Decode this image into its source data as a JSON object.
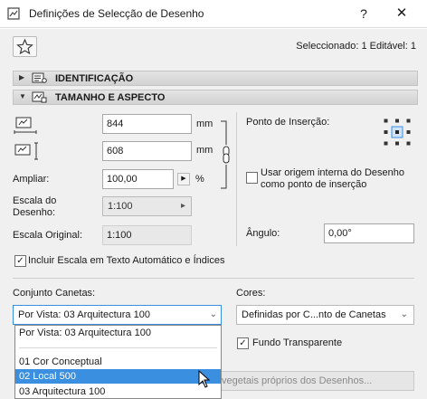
{
  "window": {
    "title": "Definições de Selecção de Desenho",
    "help": "?",
    "close": "✕"
  },
  "header": {
    "selected_info": "Seleccionado: 1 Editável: 1"
  },
  "panels": {
    "identification": "IDENTIFICAÇÃO",
    "size": "TAMANHO E ASPECTO"
  },
  "size": {
    "width_value": "844",
    "width_unit": "mm",
    "height_value": "608",
    "height_unit": "mm",
    "magnify_label": "Ampliar:",
    "magnify_value": "100,00",
    "magnify_unit": "%",
    "scale_label_line1": "Escala do",
    "scale_label_line2": "Desenho:",
    "scale_value": "1:100",
    "orig_scale_label": "Escala Original:",
    "orig_scale_value": "1:100",
    "insertion_label": "Ponto de Inserção:",
    "use_origin_line1": "Usar origem interna do Desenho",
    "use_origin_line2": "como ponto de inserção",
    "angle_label": "Ângulo:",
    "angle_value": "0,00°",
    "include_scale": "Incluir Escala em Texto Automático e Índices"
  },
  "pens": {
    "label": "Conjunto Canetas:",
    "selected": "Por Vista: 03 Arquitectura 100",
    "options": [
      "Por Vista: 03 Arquitectura 100",
      "01 Cor Conceptual",
      "02 Local 500",
      "03 Arquitectura 100"
    ],
    "highlighted_index": 2
  },
  "colors": {
    "label": "Cores:",
    "selected": "Definidas por C...nto de Canetas",
    "transparent_bg": "Fundo Transparente",
    "vegetation_button": "vegetais próprios dos Desenhos..."
  },
  "accent": "#3a8fe0"
}
